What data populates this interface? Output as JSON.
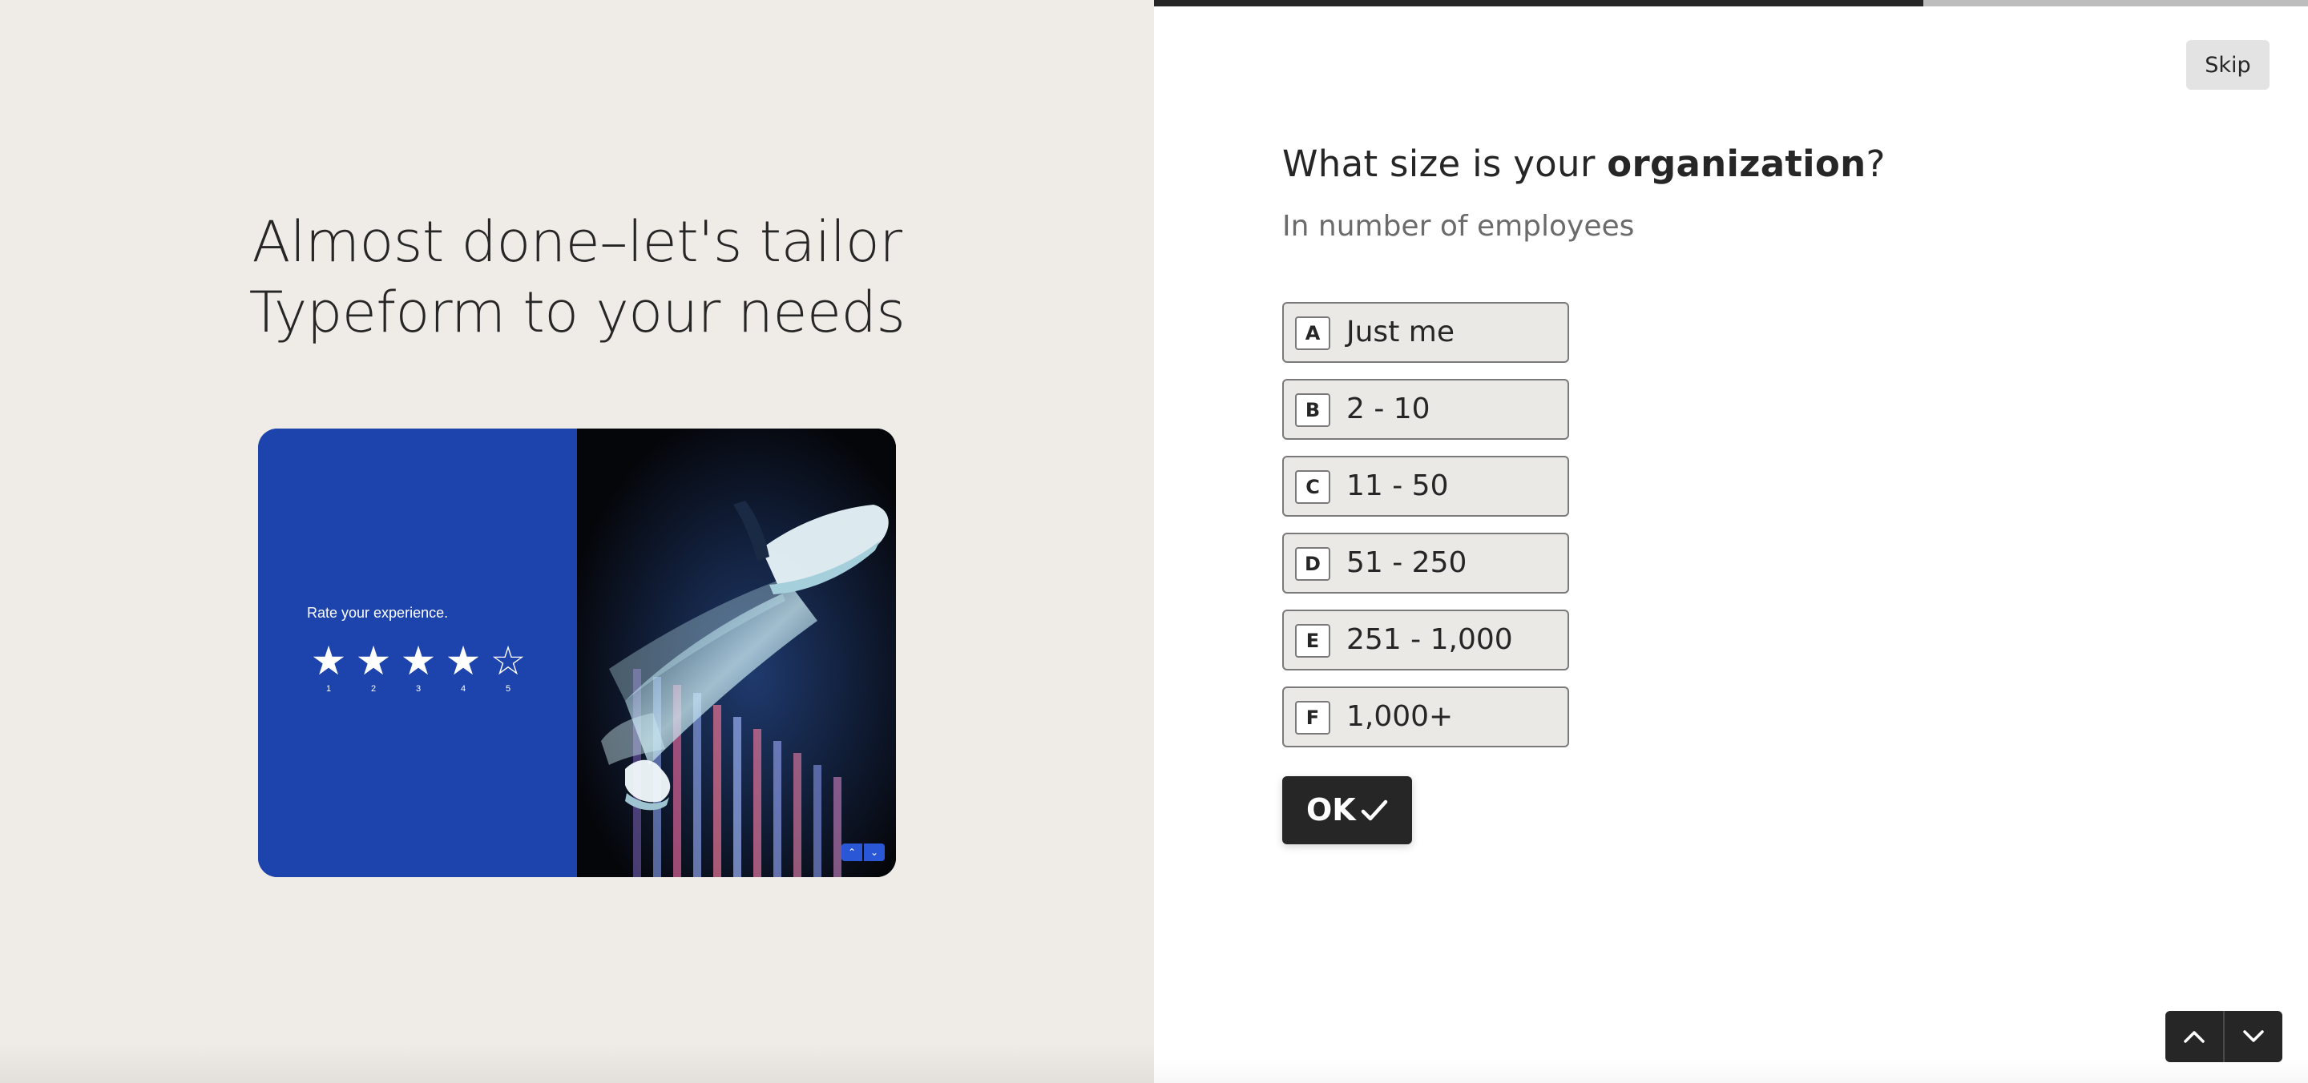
{
  "intro": {
    "headline_line1": "Almost done–let's tailor",
    "headline_line2": "Typeform to your needs"
  },
  "preview": {
    "rate_label": "Rate your experience.",
    "rating_value": 4,
    "rating_max": 5,
    "star_numbers": [
      "1",
      "2",
      "3",
      "4",
      "5"
    ],
    "star_filled_glyph": "★",
    "star_empty_glyph": "☆",
    "panel_color": "#1d44ad",
    "mini_nav_up": "⌃",
    "mini_nav_down": "⌄"
  },
  "progress": {
    "fraction": 0.667
  },
  "skip_label": "Skip",
  "question": {
    "text_prefix": "What size is your ",
    "text_bold": "organization",
    "text_suffix": "?",
    "subtitle": "In number of employees"
  },
  "choices": [
    {
      "key": "A",
      "label": "Just me"
    },
    {
      "key": "B",
      "label": "2 - 10"
    },
    {
      "key": "C",
      "label": "11 - 50"
    },
    {
      "key": "D",
      "label": "51 - 250"
    },
    {
      "key": "E",
      "label": "251 - 1,000"
    },
    {
      "key": "F",
      "label": "1,000+"
    }
  ],
  "ok_label": "OK",
  "colors": {
    "background_left": "#efebe6",
    "text": "#262626",
    "choice_fill": "#ebe9e6",
    "button_dark": "#262626"
  }
}
